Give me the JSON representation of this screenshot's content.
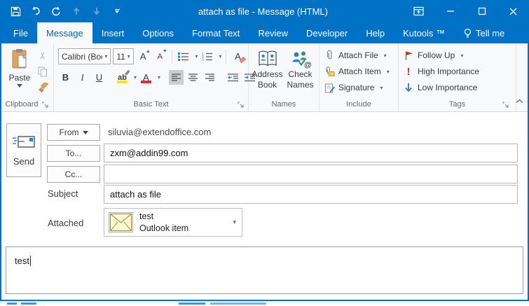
{
  "titlebar": {
    "title": "attach as file  -  Message (HTML)"
  },
  "tabs": [
    {
      "label": "File"
    },
    {
      "label": "Message"
    },
    {
      "label": "Insert"
    },
    {
      "label": "Options"
    },
    {
      "label": "Format Text"
    },
    {
      "label": "Review"
    },
    {
      "label": "Developer"
    },
    {
      "label": "Help"
    },
    {
      "label": "Kutools ™"
    },
    {
      "label": "Tell me"
    }
  ],
  "ribbon": {
    "clipboard": {
      "label": "Clipboard",
      "paste": "Paste"
    },
    "basic_text": {
      "label": "Basic Text",
      "font_name": "Calibri (Boc",
      "font_size": "11",
      "bold": "B",
      "italic": "I",
      "underline": "U",
      "grow": "A",
      "shrink": "A",
      "highlight": "ab",
      "font_color": "A",
      "clear": "A"
    },
    "names": {
      "label": "Names",
      "address_book": "Address Book",
      "check_names": "Check Names"
    },
    "include": {
      "label": "Include",
      "attach_file": "Attach File",
      "attach_item": "Attach Item",
      "signature": "Signature"
    },
    "tags": {
      "label": "Tags",
      "follow_up": "Follow Up",
      "high_importance": "High Importance",
      "low_importance": "Low Importance"
    }
  },
  "compose": {
    "send_label": "Send",
    "from_button": "From",
    "from_value": "siluvia@extendoffice.com",
    "to_button": "To...",
    "to_value": "zxm@addin99.com",
    "cc_button": "Cc...",
    "cc_value": "",
    "subject_label": "Subject",
    "subject_value": "attach as file",
    "attached_label": "Attached",
    "attachment": {
      "name": "test",
      "type": "Outlook item"
    }
  },
  "body": {
    "text": "test"
  },
  "colors": {
    "accent_blue": "#0072C6",
    "active_tab_text": "#0563C1",
    "highlight_yellow": "#FFE800",
    "font_color_red": "#E02D2D",
    "flag_red": "#CC3311",
    "importance_red": "#D13438",
    "low_importance_blue": "#2B7CD3",
    "clipboard_tan": "#E2A35C",
    "attachment_envelope_yellow": "#FCF8D0"
  }
}
